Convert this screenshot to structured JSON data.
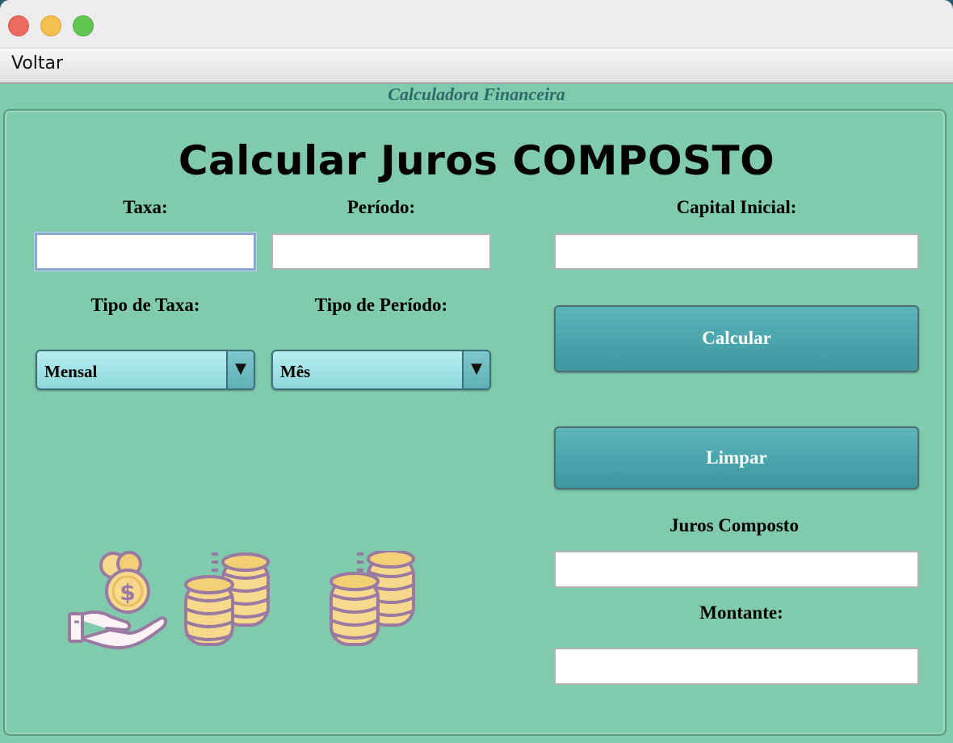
{
  "menu": {
    "back_label": "Voltar"
  },
  "frame": {
    "title": "Calculadora Financeira"
  },
  "main": {
    "title": "Calcular Juros COMPOSTO"
  },
  "form": {
    "taxa_label": "Taxa:",
    "taxa_value": "",
    "periodo_label": "Período:",
    "periodo_value": "",
    "capital_label": "Capital Inicial:",
    "capital_value": "",
    "tipo_taxa_label": "Tipo de Taxa:",
    "tipo_taxa_value": "Mensal",
    "tipo_periodo_label": "Tipo de Período:",
    "tipo_periodo_value": "Mês"
  },
  "actions": {
    "calcular_label": "Calcular",
    "limpar_label": "Limpar"
  },
  "results": {
    "juros_label": "Juros Composto",
    "juros_value": "",
    "montante_label": "Montante:",
    "montante_value": ""
  },
  "icons": [
    "hand-with-money-icon",
    "coin-stacks-icon",
    "coin-stacks-icon"
  ],
  "colors": {
    "background": "#80cbad",
    "button": "#4aa4ab",
    "combo": "#9fe0e3"
  }
}
